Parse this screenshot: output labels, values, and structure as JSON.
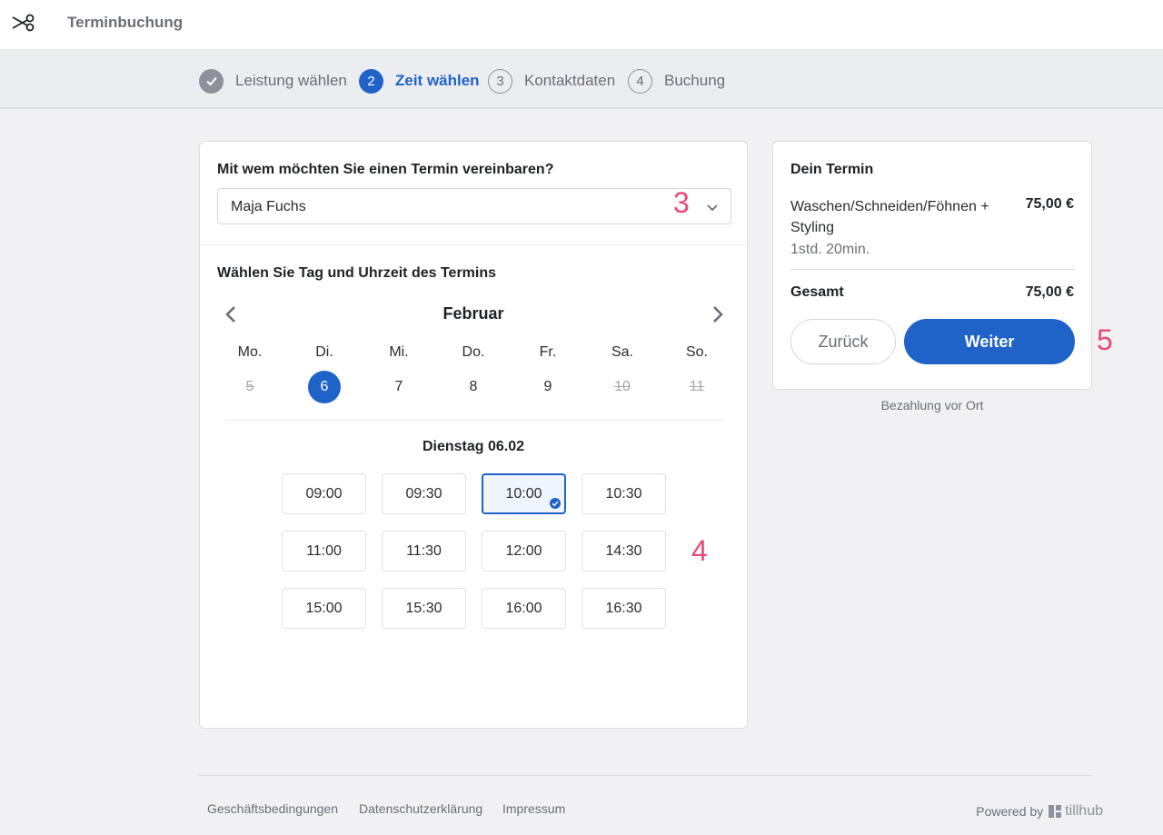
{
  "header": {
    "title": "Terminbuchung",
    "logo_icon": "scissors-icon"
  },
  "steps": [
    {
      "label": "Leistung wählen",
      "number": "",
      "state": "done"
    },
    {
      "label": "Zeit wählen",
      "number": "2",
      "state": "active"
    },
    {
      "label": "Kontaktdaten",
      "number": "3",
      "state": "todo"
    },
    {
      "label": "Buchung",
      "number": "4",
      "state": "todo"
    }
  ],
  "staff": {
    "question": "Mit wem möchten Sie einen Termin vereinbaren?",
    "selected": "Maja Fuchs"
  },
  "calendar": {
    "heading": "Wählen Sie Tag und Uhrzeit des Termins",
    "month": "Februar",
    "weekdays": [
      "Mo.",
      "Di.",
      "Mi.",
      "Do.",
      "Fr.",
      "Sa.",
      "So."
    ],
    "days": [
      "5",
      "6",
      "7",
      "8",
      "9",
      "10",
      "11"
    ],
    "selected_day_title": "Dienstag 06.02"
  },
  "slots": [
    "09:00",
    "09:30",
    "10:00",
    "10:30",
    "11:00",
    "11:30",
    "12:00",
    "14:30",
    "15:00",
    "15:30",
    "16:00",
    "16:30"
  ],
  "selected_slot": "10:00",
  "annotations": {
    "a3": "3",
    "a4": "4",
    "a5": "5"
  },
  "summary": {
    "title": "Dein Termin",
    "service": "Waschen/Schneiden/Föhnen + Styling",
    "price": "75,00 €",
    "duration": "1std. 20min.",
    "total_label": "Gesamt",
    "total_value": "75,00 €",
    "back_label": "Zurück",
    "next_label": "Weiter",
    "payment_note": "Bezahlung vor Ort"
  },
  "footer": {
    "links": [
      "Geschäftsbedingungen",
      "Datenschutzerklärung",
      "Impressum"
    ],
    "powered_by": "Powered by",
    "brand": "tillhub"
  },
  "colors": {
    "primary": "#1f62c8",
    "annotation": "#e64b74"
  }
}
